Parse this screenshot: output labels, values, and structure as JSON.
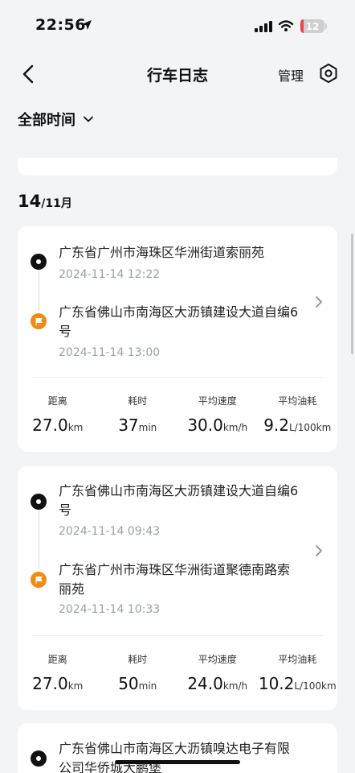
{
  "status_bar": {
    "time": "22:56",
    "battery": "12"
  },
  "nav": {
    "title": "行车日志",
    "manage": "管理"
  },
  "filter": {
    "label": "全部时间"
  },
  "date_group": {
    "day": "14",
    "month": "/11月"
  },
  "trips": [
    {
      "start_address": "广东省广州市海珠区华洲街道索丽苑",
      "start_time": "2024-11-14 12:22",
      "end_address": "广东省佛山市南海区大沥镇建设大道自编6号",
      "end_time": "2024-11-14 13:00",
      "stats": [
        {
          "label": "距离",
          "value": "27.0",
          "unit": "km"
        },
        {
          "label": "耗时",
          "value": "37",
          "unit": "min"
        },
        {
          "label": "平均速度",
          "value": "30.0",
          "unit": "km/h"
        },
        {
          "label": "平均油耗",
          "value": "9.2",
          "unit": "L/100km"
        }
      ]
    },
    {
      "start_address": "广东省佛山市南海区大沥镇建设大道自编6号",
      "start_time": "2024-11-14 09:43",
      "end_address": "广东省广州市海珠区华洲街道聚德南路索丽苑",
      "end_time": "2024-11-14 10:33",
      "stats": [
        {
          "label": "距离",
          "value": "27.0",
          "unit": "km"
        },
        {
          "label": "耗时",
          "value": "50",
          "unit": "min"
        },
        {
          "label": "平均速度",
          "value": "24.0",
          "unit": "km/h"
        },
        {
          "label": "平均油耗",
          "value": "10.2",
          "unit": "L/100km"
        }
      ]
    },
    {
      "start_address": "广东省佛山市南海区大沥镇嗅达电子有限公司华侨城大鹏堡"
    }
  ],
  "colors": {
    "accent_orange": "#f08b13",
    "background": "#f3f4f6",
    "card": "#ffffff"
  }
}
